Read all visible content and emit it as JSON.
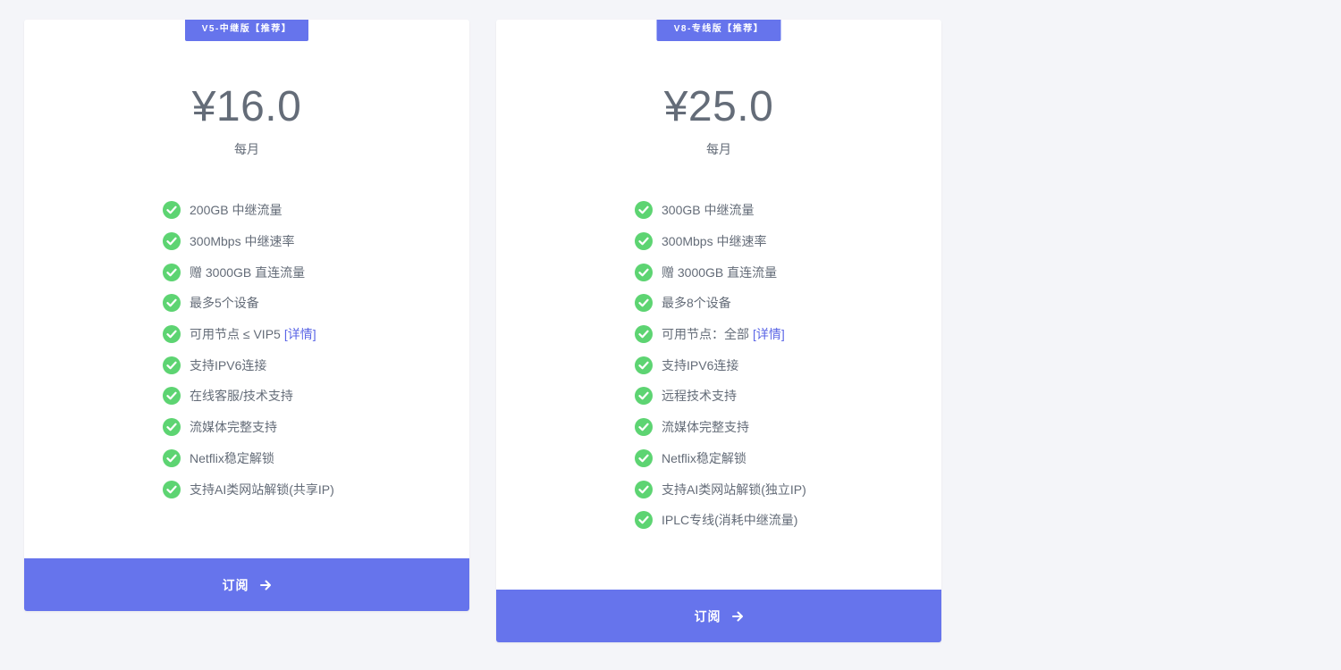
{
  "plans": [
    {
      "badge": "V5-中继版【推荐】",
      "price": "¥16.0",
      "period": "每月",
      "features": [
        {
          "text": "200GB 中继流量"
        },
        {
          "text": "300Mbps 中继速率"
        },
        {
          "text": "赠 3000GB 直连流量"
        },
        {
          "text": "最多5个设备"
        },
        {
          "text": "可用节点 ≤ VIP5",
          "link": "[详情]"
        },
        {
          "text": "支持IPV6连接"
        },
        {
          "text": "在线客服/技术支持"
        },
        {
          "text": "流媒体完整支持"
        },
        {
          "text": "Netflix稳定解锁"
        },
        {
          "text": "支持AI类网站解锁(共享IP)"
        }
      ],
      "button_label": "订阅"
    },
    {
      "badge": "V8-专线版【推荐】",
      "price": "¥25.0",
      "period": "每月",
      "features": [
        {
          "text": "300GB 中继流量"
        },
        {
          "text": "300Mbps 中继速率"
        },
        {
          "text": "赠 3000GB 直连流量"
        },
        {
          "text": "最多8个设备"
        },
        {
          "text": "可用节点：全部",
          "link": "[详情]"
        },
        {
          "text": "支持IPV6连接"
        },
        {
          "text": "远程技术支持"
        },
        {
          "text": "流媒体完整支持"
        },
        {
          "text": "Netflix稳定解锁"
        },
        {
          "text": "支持AI类网站解锁(独立IP)"
        },
        {
          "text": "IPLC专线(消耗中继流量)"
        }
      ],
      "button_label": "订阅"
    }
  ],
  "icons": {
    "feature": "check-circle-icon",
    "button": "arrow-right-icon"
  },
  "colors": {
    "accent": "#6674ec",
    "check": "#5dd472",
    "link": "#5b66e6",
    "text": "#646c78",
    "background": "#f4f5f9"
  }
}
